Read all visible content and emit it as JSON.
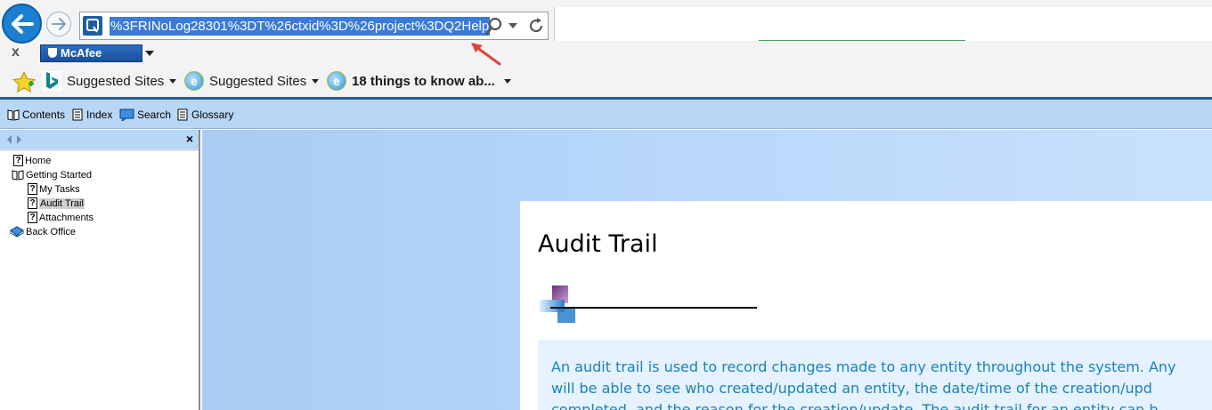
{
  "browser": {
    "url_text": "%3FRINoLog28301%3DT%26ctxid%3D%26project%3DQ2Help",
    "toolbar_close": "x",
    "mcafee_label": "McAfee",
    "favorites": [
      {
        "label": "Suggested Sites",
        "icon": "bing-icon"
      },
      {
        "label": "Suggested Sites",
        "icon": "ie-icon"
      },
      {
        "label": "18 things to know ab...",
        "icon": "ie-icon"
      }
    ]
  },
  "help_toolbar": {
    "items": [
      {
        "label": "Contents",
        "icon": "book-icon"
      },
      {
        "label": "Index",
        "icon": "index-icon"
      },
      {
        "label": "Search",
        "icon": "search-icon"
      },
      {
        "label": "Glossary",
        "icon": "glossary-icon"
      }
    ]
  },
  "nav_pane": {
    "close": "×",
    "tree": [
      {
        "label": "Home",
        "icon": "topic-icon",
        "level": 0
      },
      {
        "label": "Getting Started",
        "icon": "open-book-icon",
        "level": 0
      },
      {
        "label": "My Tasks",
        "icon": "topic-icon",
        "level": 1
      },
      {
        "label": "Audit Trail",
        "icon": "topic-icon",
        "level": 1,
        "selected": true
      },
      {
        "label": "Attachments",
        "icon": "topic-icon",
        "level": 1
      },
      {
        "label": "Back Office",
        "icon": "closed-book-icon",
        "level": 0
      }
    ]
  },
  "document": {
    "title": "Audit Trail",
    "body_lines": [
      "An audit trail is used to record changes made to any entity throughout the system. Any",
      "will be able to see who created/updated an entity, the date/time of the creation/upd",
      "completed, and the reason for the creation/update. The audit trail for an entity can b"
    ]
  },
  "colors": {
    "accent": "#1c7fcf",
    "url_highlight": "#3b7ad6",
    "toolbar_bg": "#b8d7f7",
    "body_text": "#1784b8",
    "callout_bg": "#e6f2ff"
  }
}
